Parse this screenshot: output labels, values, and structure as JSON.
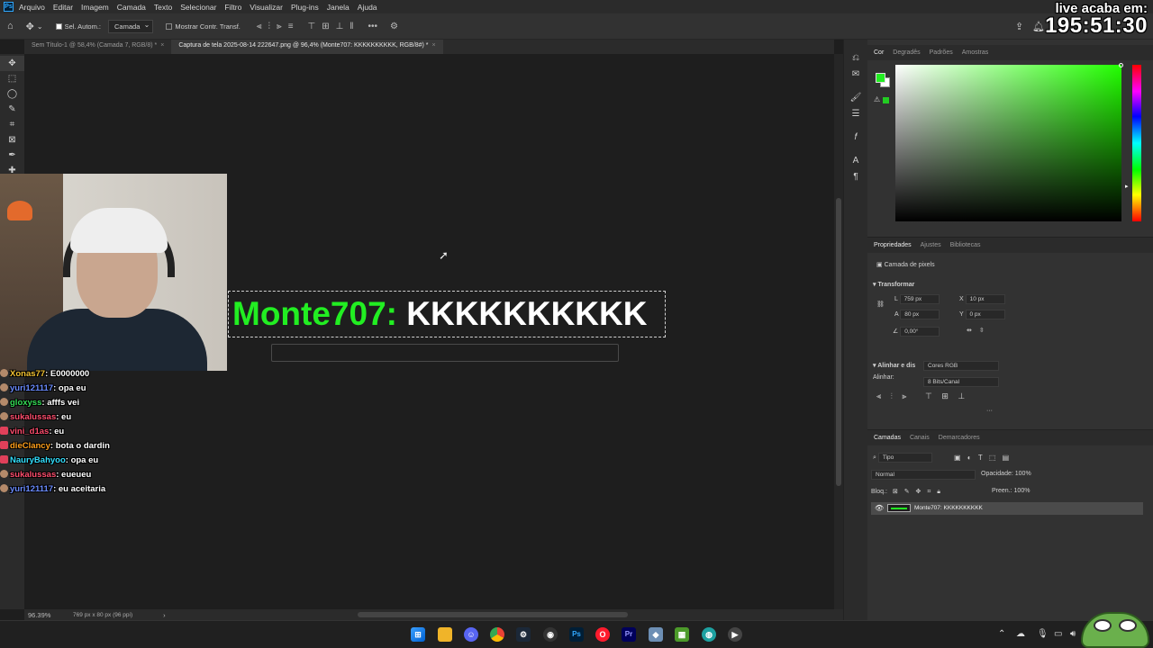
{
  "app": {
    "menu": [
      "Arquivo",
      "Editar",
      "Imagem",
      "Camada",
      "Texto",
      "Selecionar",
      "Filtro",
      "Visualizar",
      "Plug-ins",
      "Janela",
      "Ajuda"
    ]
  },
  "options_bar": {
    "auto_select_label": "Sel. Autom.:",
    "auto_select_target": "Camada",
    "show_transform_label": "Mostrar Contr. Transf."
  },
  "overlay": {
    "timer_label": "live acaba em:",
    "timer_value": "195:51:30"
  },
  "tabs": [
    {
      "label": "Sem Título-1 @ 58,4% (Camada 7, RGB/8) *",
      "active": false
    },
    {
      "label": "Captura de tela 2025-08-14 222647.png @ 96,4% (Monte707: KKKKKKKKKK, RGB/8#) *",
      "active": true
    }
  ],
  "canvas": {
    "chat_name": "Monte707:",
    "chat_message": "KKKKKKKKKK"
  },
  "status": {
    "zoom": "96.39%",
    "dims": "769 px x 80 px (96 ppi)"
  },
  "color_panel": {
    "tabs": [
      "Cor",
      "Degradês",
      "Padrões",
      "Amostras"
    ],
    "foreground": "#22ee22"
  },
  "properties": {
    "tabs": [
      "Propriedades",
      "Ajustes",
      "Bibliotecas"
    ],
    "layer_kind": "Camada de pixels",
    "transform_label": "Transformar",
    "w_label": "L",
    "w_value": "759 px",
    "h_label": "A",
    "h_value": "80 px",
    "x_label": "X",
    "x_value": "10 px",
    "y_label": "Y",
    "y_value": "0 px",
    "angle_value": "0,00°",
    "align_label": "Alinhar e dis",
    "color_mode": "Cores RGB",
    "align_short": "Alinhar:",
    "bit_depth": "8 Bits/Canal"
  },
  "layers": {
    "tabs": [
      "Camadas",
      "Canais",
      "Demarcadores"
    ],
    "filter": "Tipo",
    "blend_mode": "Normal",
    "opacity_label": "Opacidade:",
    "opacity_value": "100%",
    "lock_label": "Bloq.:",
    "fill_label": "Preen.:",
    "fill_value": "100%",
    "layer_name": "Monte707: KKKKKKKKKK"
  },
  "chat": [
    {
      "user": "Xonas77",
      "message": "E0000000",
      "color": "#f0c030"
    },
    {
      "user": "yuri121117",
      "message": "opa eu",
      "color": "#6b8cff"
    },
    {
      "user": "gloxyss",
      "message": "afffs vei",
      "color": "#33dd55"
    },
    {
      "user": "sukalussas",
      "message": "eu",
      "color": "#ff4d6d"
    },
    {
      "user": "vini_d1as",
      "message": "eu",
      "color": "#ff4d6d"
    },
    {
      "user": "dieClancy",
      "message": "bota o dardin",
      "color": "#ff9f1a"
    },
    {
      "user": "NauryBahyoo",
      "message": "opa eu",
      "color": "#33e0ff"
    },
    {
      "user": "sukalussas",
      "message": "eueueu",
      "color": "#ff4d6d"
    },
    {
      "user": "yuri121117",
      "message": "eu aceitaria",
      "color": "#6b8cff"
    }
  ]
}
